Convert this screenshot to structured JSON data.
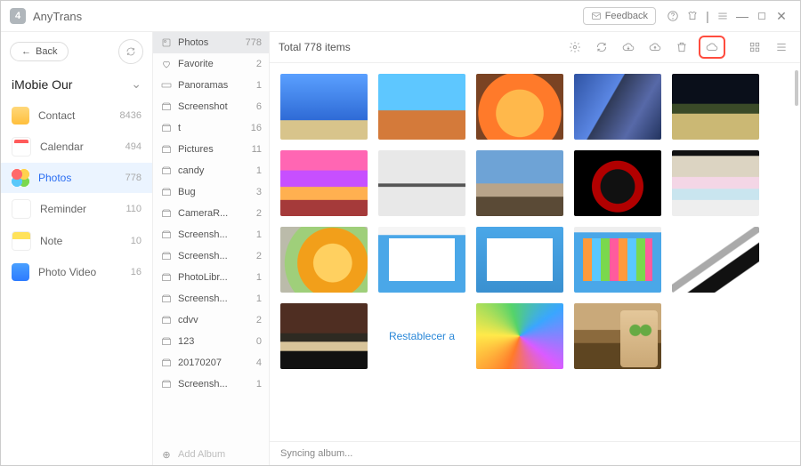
{
  "titlebar": {
    "app_name": "AnyTrans",
    "feedback": "Feedback"
  },
  "sidebar": {
    "back": "Back",
    "device": "iMobie Our",
    "items": [
      {
        "label": "Contact",
        "count": "8436"
      },
      {
        "label": "Calendar",
        "count": "494"
      },
      {
        "label": "Photos",
        "count": "778"
      },
      {
        "label": "Reminder",
        "count": "110"
      },
      {
        "label": "Note",
        "count": "10"
      },
      {
        "label": "Photo Video",
        "count": "16"
      }
    ]
  },
  "albums": [
    {
      "label": "Photos",
      "count": "778"
    },
    {
      "label": "Favorite",
      "count": "2"
    },
    {
      "label": "Panoramas",
      "count": "1"
    },
    {
      "label": "Screenshot",
      "count": "6"
    },
    {
      "label": "t",
      "count": "16"
    },
    {
      "label": "Pictures",
      "count": "11"
    },
    {
      "label": "candy",
      "count": "1"
    },
    {
      "label": "Bug",
      "count": "3"
    },
    {
      "label": "CameraR...",
      "count": "2"
    },
    {
      "label": "Screensh...",
      "count": "1"
    },
    {
      "label": "Screensh...",
      "count": "2"
    },
    {
      "label": "PhotoLibr...",
      "count": "1"
    },
    {
      "label": "Screensh...",
      "count": "1"
    },
    {
      "label": "cdvv",
      "count": "2"
    },
    {
      "label": "123",
      "count": "0"
    },
    {
      "label": "20170207",
      "count": "4"
    },
    {
      "label": "Screensh...",
      "count": "1"
    }
  ],
  "add_album": "Add Album",
  "toolbar": {
    "total": "Total 778 items"
  },
  "status": "Syncing album...",
  "thumb_text": {
    "restablecer": "Restablecer a"
  }
}
